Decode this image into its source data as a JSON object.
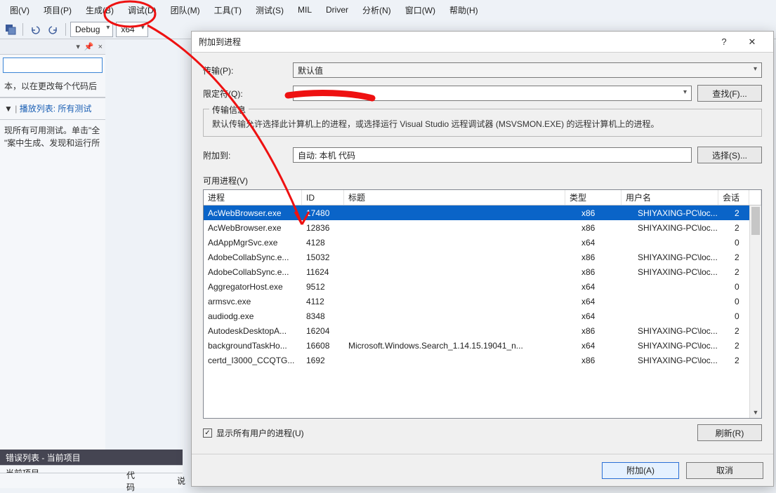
{
  "menus": {
    "view": "图(V)",
    "project": "项目(P)",
    "build": "生成(B)",
    "debug": "调试(D)",
    "team": "团队(M)",
    "tools": "工具(T)",
    "test": "测试(S)",
    "mil": "MIL",
    "driver": "Driver",
    "analyze": "分析(N)",
    "window": "窗口(W)",
    "help": "帮助(H)"
  },
  "toolbar": {
    "config": "Debug",
    "platform": "x64"
  },
  "left_panel": {
    "panel_tools": {
      "pin": "📌",
      "close": "×"
    },
    "hint1": "本，以在更改每个代码后",
    "playlist_prefix": "▼",
    "playlist_sep": "|",
    "playlist": "播放列表: 所有测试",
    "hint2a": "现所有可用测试。单击\"全",
    "hint2b": "\"案中生成、发现和运行所"
  },
  "error_list": {
    "title": "错误列表 - 当前项目",
    "tab": "当前项目",
    "col_code": "代码",
    "col_desc": "说"
  },
  "dialog": {
    "title": "附加到进程",
    "help_btn": "?",
    "close_btn": "✕",
    "transport_label": "传输(P):",
    "transport_value": "默认值",
    "qualifier_label": "限定符(Q):",
    "find_btn": "查找(F)...",
    "groupbox_legend": "传输信息",
    "groupbox_info": "默认传输允许选择此计算机上的进程，或选择运行 Visual Studio 远程调试器 (MSVSMON.EXE) 的远程计算机上的进程。",
    "attach_to_label": "附加到:",
    "attach_to_value": "自动: 本机 代码",
    "select_btn": "选择(S)...",
    "available_label": "可用进程(V)",
    "columns": {
      "process": "进程",
      "id": "ID",
      "title": "标题",
      "type": "类型",
      "user": "用户名",
      "session": "会话"
    },
    "rows": [
      {
        "proc": "AcWebBrowser.exe",
        "id": "17480",
        "title": "",
        "type": "x86",
        "user": "SHIYAXING-PC\\loc...",
        "sess": "2",
        "selected": true
      },
      {
        "proc": "AcWebBrowser.exe",
        "id": "12836",
        "title": "",
        "type": "x86",
        "user": "SHIYAXING-PC\\loc...",
        "sess": "2"
      },
      {
        "proc": "AdAppMgrSvc.exe",
        "id": "4128",
        "title": "",
        "type": "x64",
        "user": "",
        "sess": "0"
      },
      {
        "proc": "AdobeCollabSync.e...",
        "id": "15032",
        "title": "",
        "type": "x86",
        "user": "SHIYAXING-PC\\loc...",
        "sess": "2"
      },
      {
        "proc": "AdobeCollabSync.e...",
        "id": "11624",
        "title": "",
        "type": "x86",
        "user": "SHIYAXING-PC\\loc...",
        "sess": "2"
      },
      {
        "proc": "AggregatorHost.exe",
        "id": "9512",
        "title": "",
        "type": "x64",
        "user": "",
        "sess": "0"
      },
      {
        "proc": "armsvc.exe",
        "id": "4112",
        "title": "",
        "type": "x64",
        "user": "",
        "sess": "0"
      },
      {
        "proc": "audiodg.exe",
        "id": "8348",
        "title": "",
        "type": "x64",
        "user": "",
        "sess": "0"
      },
      {
        "proc": "AutodeskDesktopA...",
        "id": "16204",
        "title": "",
        "type": "x86",
        "user": "SHIYAXING-PC\\loc...",
        "sess": "2"
      },
      {
        "proc": "backgroundTaskHo...",
        "id": "16608",
        "title": "Microsoft.Windows.Search_1.14.15.19041_n...",
        "type": "x64",
        "user": "SHIYAXING-PC\\loc...",
        "sess": "2"
      },
      {
        "proc": "certd_I3000_CCQTG...",
        "id": "1692",
        "title": "",
        "type": "x86",
        "user": "SHIYAXING-PC\\loc...",
        "sess": "2"
      }
    ],
    "show_all_users": "显示所有用户的进程(U)",
    "refresh_btn": "刷新(R)",
    "attach_btn": "附加(A)",
    "cancel_btn": "取消"
  }
}
